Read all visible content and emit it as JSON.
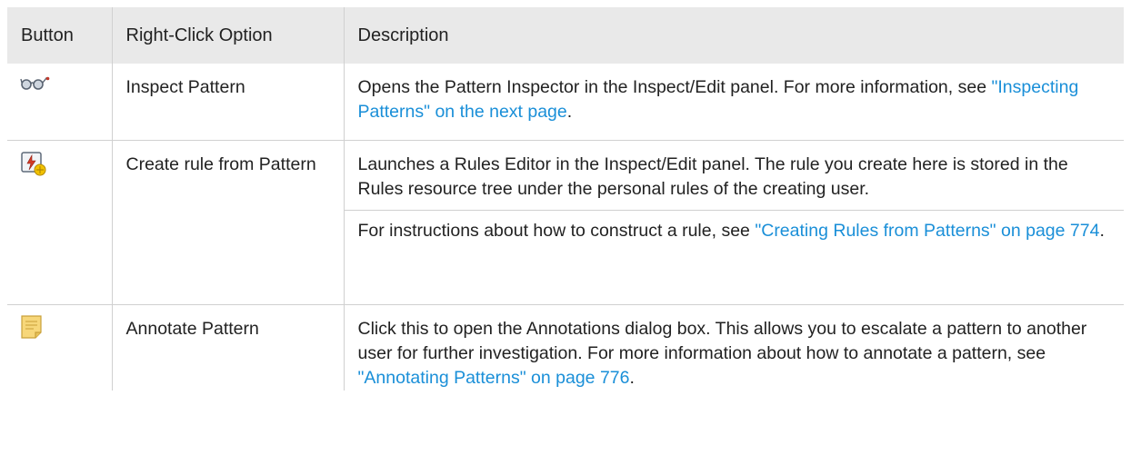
{
  "table": {
    "headers": [
      "Button",
      "Right-Click Option",
      "Description"
    ],
    "rows": [
      {
        "icon": "glasses-icon",
        "option": "Inspect Pattern",
        "desc_1_text": "Opens the Pattern Inspector in the Inspect/Edit panel. For more information, see ",
        "desc_1_link": "\"Inspecting Patterns\" on the next page",
        "desc_1_end": "."
      },
      {
        "icon": "create-rule-icon",
        "option": "Create rule from Pattern",
        "desc_1_text": "Launches a Rules Editor in the Inspect/Edit panel. The rule you create here is stored in the Rules resource tree under the personal rules of the creating user.",
        "desc_2_text": "For instructions about how to construct a rule, see ",
        "desc_2_link": "\"Creating Rules from Patterns\" on page 774",
        "desc_2_end": "."
      },
      {
        "icon": "sticky-note-icon",
        "option": "Annotate Pattern",
        "desc_1_text": "Click this to open the Annotations dialog box. This allows you to escalate a pattern to another user for further investigation. For more information about how to annotate a pattern, see ",
        "desc_1_link": "\"Annotating Patterns\" on page 776",
        "desc_1_end": "."
      }
    ]
  },
  "colors": {
    "header_bg": "#e9e9e9",
    "link": "#1a8fd8",
    "border": "#d0d0d0"
  }
}
